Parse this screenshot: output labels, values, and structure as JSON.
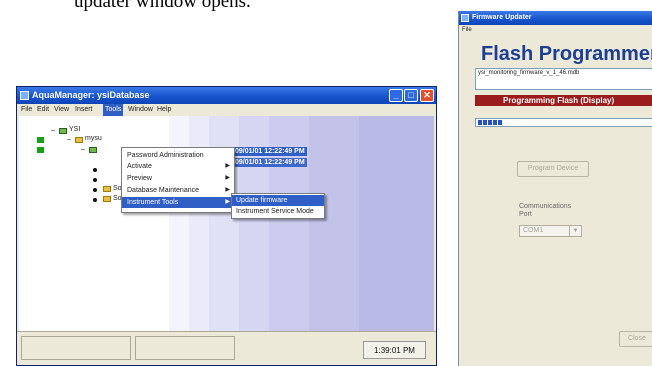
{
  "caption": "updater window opens.",
  "aqua": {
    "title": "AquaManager: ysiDatabase",
    "controls": {
      "minimize": "_",
      "maximize": "□",
      "close": "✕"
    },
    "menus": [
      "File",
      "Edit",
      "View",
      "Insert",
      "Tools",
      "Window",
      "Help"
    ],
    "active_menu": "Tools",
    "tree": {
      "root": "YSI",
      "child": "mysu",
      "sondes": [
        "Sonde 3",
        "Sonde 4"
      ],
      "highlight_row1": "09/01/01 12:22:49 PM",
      "highlight_row2": "09/01/01 12:22:49 PM"
    },
    "tools_menu": [
      {
        "label": "Password Administration",
        "has_sub": false
      },
      {
        "label": "Activate",
        "has_sub": true
      },
      {
        "label": "Preview",
        "has_sub": true
      },
      {
        "label": "Database Maintenance",
        "has_sub": true
      },
      {
        "label": "Instrument Tools",
        "has_sub": true,
        "selected": true
      }
    ],
    "submenu": [
      "Update firmware",
      "Instrument Service Mode"
    ],
    "status_time": "1:39:01 PM"
  },
  "fw": {
    "title": "Firmware Updater",
    "menu": "File",
    "heading": "Flash Programmer",
    "file": "ysi_monitoring_firmware_v_1_46.mdb",
    "status": "Programming Flash (Display)",
    "program_button": "Program Device",
    "comm_label_1": "Communications",
    "comm_label_2": "Port",
    "port": "COM1",
    "close_button": "Close"
  },
  "colors": {
    "accent": "#2f5fc6",
    "status_red": "#9b1c1c",
    "title_blue": "#1c3f94"
  }
}
